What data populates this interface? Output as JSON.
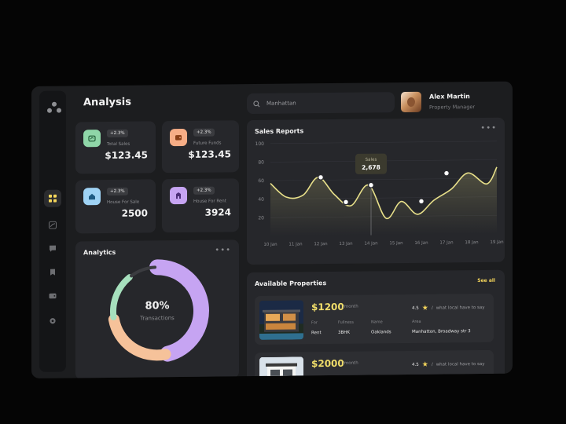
{
  "header": {
    "title": "Analysis",
    "search_value": "Manhattan"
  },
  "user": {
    "name": "Alex Martin",
    "role": "Property Manager"
  },
  "sidebar": {
    "icons": [
      "grid-icon",
      "chart-icon",
      "message-icon",
      "bookmark-icon",
      "wallet-icon",
      "settings-icon"
    ],
    "active": "grid-icon"
  },
  "stats": [
    {
      "badge": "+2.3%",
      "label": "Total Sales",
      "value": "$123.45",
      "color": "#8fd6a8",
      "icon": "wallet-icon"
    },
    {
      "badge": "+2.3%",
      "label": "Future Funds",
      "value": "$123.45",
      "color": "#f6ad86",
      "icon": "wallet-icon"
    },
    {
      "badge": "+2.3%",
      "label": "House For Sale",
      "value": "2500",
      "color": "#9fd3f5",
      "icon": "home-icon"
    },
    {
      "badge": "+2.3%",
      "label": "House For Rent",
      "value": "3924",
      "color": "#c6a4f2",
      "icon": "building-icon"
    }
  ],
  "analytics": {
    "title": "Analytics",
    "percent": "80%",
    "caption": "Transactions",
    "segments": [
      {
        "color": "#c6a4f2",
        "fraction": 0.47
      },
      {
        "color": "#f6c29a",
        "fraction": 0.26
      },
      {
        "color": "#a6e0bd",
        "fraction": 0.17
      },
      {
        "color": "#3b3c40",
        "fraction": 0.1
      }
    ]
  },
  "sales": {
    "title": "Sales Reports",
    "tooltip_label": "Sales",
    "tooltip_value": "2,678"
  },
  "chart_data": {
    "type": "line",
    "title": "Sales Reports",
    "xlabel": "",
    "ylabel": "",
    "categories": [
      "10 Jan",
      "11 Jan",
      "12 Jan",
      "13 Jan",
      "14 Jan",
      "15 Jan",
      "16 Jan",
      "17 Jan",
      "18 Jan",
      "19 Jan"
    ],
    "y_ticks": [
      20,
      40,
      60,
      80,
      100
    ],
    "ylim": [
      0,
      100
    ],
    "x_positions": [
      0.0,
      0.63,
      1.3,
      1.9,
      2.55,
      3.2,
      3.9,
      4.6,
      5.2,
      5.85,
      6.5,
      7.2,
      7.85,
      8.6,
      9.0
    ],
    "values": [
      57,
      42,
      44,
      63,
      44,
      32,
      54,
      18,
      36,
      22,
      37,
      49,
      66,
      54,
      72
    ],
    "highlighted": [
      {
        "x": 2.0,
        "y": 63
      },
      {
        "x": 3.0,
        "y": 36
      },
      {
        "x": 4.0,
        "y": 54
      },
      {
        "x": 6.0,
        "y": 36
      },
      {
        "x": 7.0,
        "y": 66
      }
    ],
    "tooltip_index": 2,
    "grid": true,
    "line_color": "#e8e08a"
  },
  "properties": {
    "title": "Available Properties",
    "see_all": "See all",
    "items": [
      {
        "price": "$1200",
        "per": "/month",
        "rating": "4.5",
        "note": "what local have to say",
        "fields": [
          {
            "label": "For",
            "value": "Rent"
          },
          {
            "label": "Fullness",
            "value": "3BHK"
          },
          {
            "label": "Name",
            "value": "Oaklands"
          },
          {
            "label": "Area",
            "value": "Manhatton, Broadway str 3"
          }
        ]
      },
      {
        "price": "$2000",
        "per": "/month",
        "rating": "4.5",
        "note": "what local have to say",
        "fields": []
      }
    ]
  }
}
